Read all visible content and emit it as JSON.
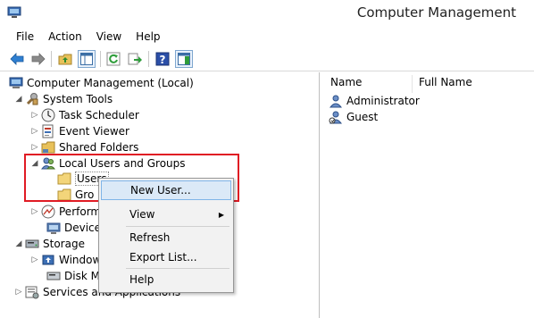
{
  "window": {
    "title": "Computer Management"
  },
  "menu": [
    "File",
    "Action",
    "View",
    "Help"
  ],
  "tree": {
    "root": "Computer Management (Local)",
    "system_tools": "System Tools",
    "task_scheduler": "Task Scheduler",
    "event_viewer": "Event Viewer",
    "shared_folders": "Shared Folders",
    "local_users_groups": "Local Users and Groups",
    "users": "Users",
    "groups": "Gro",
    "performance": "Perform",
    "device_manager": "Device",
    "storage": "Storage",
    "windows_backup": "Window",
    "disk_management": "Disk Ma",
    "services_apps": "Services and Applications"
  },
  "list": {
    "columns": [
      "Name",
      "Full Name"
    ],
    "rows": [
      {
        "name": "Administrator",
        "full_name": ""
      },
      {
        "name": "Guest",
        "full_name": ""
      }
    ]
  },
  "context_menu": {
    "new_user": "New User...",
    "view": "View",
    "refresh": "Refresh",
    "export_list": "Export List...",
    "help": "Help"
  },
  "colors": {
    "highlight_border": "#e01b24",
    "menu_hover": "#dbe9f7",
    "accent": "#7fb4e8"
  },
  "icons": [
    "back-icon",
    "forward-icon",
    "up-folder-icon",
    "show-hide-tree-icon",
    "refresh-icon",
    "export-list-icon",
    "help-icon",
    "action-pane-icon"
  ]
}
